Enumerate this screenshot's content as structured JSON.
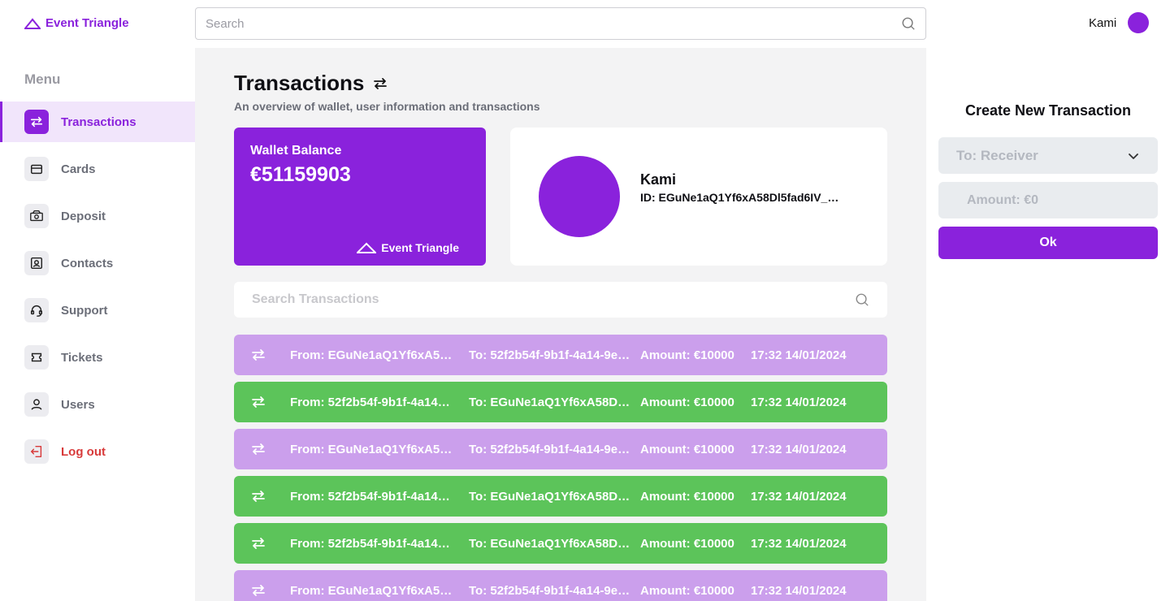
{
  "brand": {
    "name": "Event Triangle"
  },
  "header": {
    "search_placeholder": "Search",
    "user_name": "Kami"
  },
  "sidebar": {
    "menu_title": "Menu",
    "items": [
      {
        "label": "Transactions",
        "icon": "transactions-icon"
      },
      {
        "label": "Cards",
        "icon": "card-icon"
      },
      {
        "label": "Deposit",
        "icon": "deposit-icon"
      },
      {
        "label": "Contacts",
        "icon": "contacts-icon"
      },
      {
        "label": "Support",
        "icon": "headset-icon"
      },
      {
        "label": "Tickets",
        "icon": "ticket-icon"
      },
      {
        "label": "Users",
        "icon": "user-icon"
      },
      {
        "label": "Log out",
        "icon": "logout-icon"
      }
    ]
  },
  "main": {
    "title": "Transactions",
    "subtitle": "An overview of wallet, user information and transactions",
    "wallet": {
      "label": "Wallet Balance",
      "value": "€51159903",
      "brand": "Event Triangle"
    },
    "profile": {
      "name": "Kami",
      "id": "ID: EGuNe1aQ1Yf6xA58Dl5fad6IV_…"
    },
    "tx_search_placeholder": "Search Transactions",
    "transactions": [
      {
        "from": "From: EGuNe1aQ1Yf6xA5…",
        "to": "To: 52f2b54f-9b1f-4a14-9e…",
        "amount": "Amount: €10000",
        "date": "17:32 14/01/2024",
        "type": "out"
      },
      {
        "from": "From: 52f2b54f-9b1f-4a14…",
        "to": "To: EGuNe1aQ1Yf6xA58D…",
        "amount": "Amount: €10000",
        "date": "17:32 14/01/2024",
        "type": "in"
      },
      {
        "from": "From: EGuNe1aQ1Yf6xA5…",
        "to": "To: 52f2b54f-9b1f-4a14-9e…",
        "amount": "Amount: €10000",
        "date": "17:32 14/01/2024",
        "type": "out"
      },
      {
        "from": "From: 52f2b54f-9b1f-4a14…",
        "to": "To: EGuNe1aQ1Yf6xA58D…",
        "amount": "Amount: €10000",
        "date": "17:32 14/01/2024",
        "type": "in"
      },
      {
        "from": "From: 52f2b54f-9b1f-4a14…",
        "to": "To: EGuNe1aQ1Yf6xA58D…",
        "amount": "Amount: €10000",
        "date": "17:32 14/01/2024",
        "type": "in"
      },
      {
        "from": "From: EGuNe1aQ1Yf6xA5…",
        "to": "To: 52f2b54f-9b1f-4a14-9e…",
        "amount": "Amount: €10000",
        "date": "17:32 14/01/2024",
        "type": "out"
      }
    ]
  },
  "create": {
    "title": "Create New Transaction",
    "receiver_placeholder": "To: Receiver",
    "amount_placeholder": "Amount: €0",
    "ok_label": "Ok"
  },
  "colors": {
    "accent": "#8a22dc",
    "out_row": "#cb9fec",
    "in_row": "#5cc45a",
    "logout": "#d83a3a"
  }
}
